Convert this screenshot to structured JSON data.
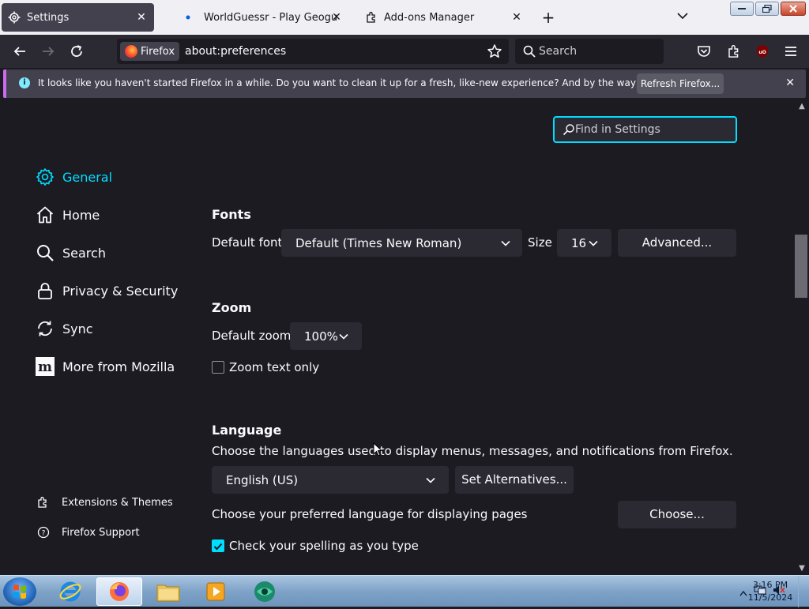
{
  "tabs": [
    {
      "label": "Settings",
      "active": true,
      "icon": "gear-icon"
    },
    {
      "label": "WorldGuessr - Play Geoguessr f",
      "active": false,
      "icon": "dot-icon"
    },
    {
      "label": "Add-ons Manager",
      "active": false,
      "icon": "puzzle-icon"
    }
  ],
  "toolbar": {
    "identity_label": "Firefox",
    "url": "about:preferences",
    "search_placeholder": "Search"
  },
  "notification": {
    "message": "It looks like you haven't started Firefox in a while. Do you want to clean it up for a fresh, like-new experience? And by the way, welcome back!",
    "button": "Refresh Firefox..."
  },
  "find": {
    "placeholder": "Find in Settings"
  },
  "sidebar": {
    "items": [
      {
        "label": "General",
        "icon": "gear-icon",
        "selected": true
      },
      {
        "label": "Home",
        "icon": "home-icon"
      },
      {
        "label": "Search",
        "icon": "search-icon"
      },
      {
        "label": "Privacy & Security",
        "icon": "lock-icon"
      },
      {
        "label": "Sync",
        "icon": "sync-icon"
      },
      {
        "label": "More from Mozilla",
        "icon": "mozilla-icon"
      }
    ],
    "footer": [
      {
        "label": "Extensions & Themes",
        "icon": "puzzle-icon"
      },
      {
        "label": "Firefox Support",
        "icon": "help-icon"
      }
    ]
  },
  "fonts": {
    "heading": "Fonts",
    "default_font_label": "Default font",
    "default_font_value": "Default (Times New Roman)",
    "size_label": "Size",
    "size_value": "16",
    "advanced_button": "Advanced..."
  },
  "zoom": {
    "heading": "Zoom",
    "default_zoom_label": "Default zoom",
    "default_zoom_value": "100%",
    "text_only_label": "Zoom text only",
    "text_only_checked": false
  },
  "language": {
    "heading": "Language",
    "description": "Choose the languages used to display menus, messages, and notifications from Firefox.",
    "selected": "English (US)",
    "alternatives_button": "Set Alternatives...",
    "pages_label": "Choose your preferred language for displaying pages",
    "choose_button": "Choose...",
    "spellcheck_label": "Check your spelling as you type",
    "spellcheck_checked": true
  },
  "taskbar": {
    "time": "3:16 PM",
    "date": "11/5/2024"
  },
  "colors": {
    "accent": "#00ddff",
    "background": "#1c1b22",
    "surface": "#2b2a33"
  }
}
